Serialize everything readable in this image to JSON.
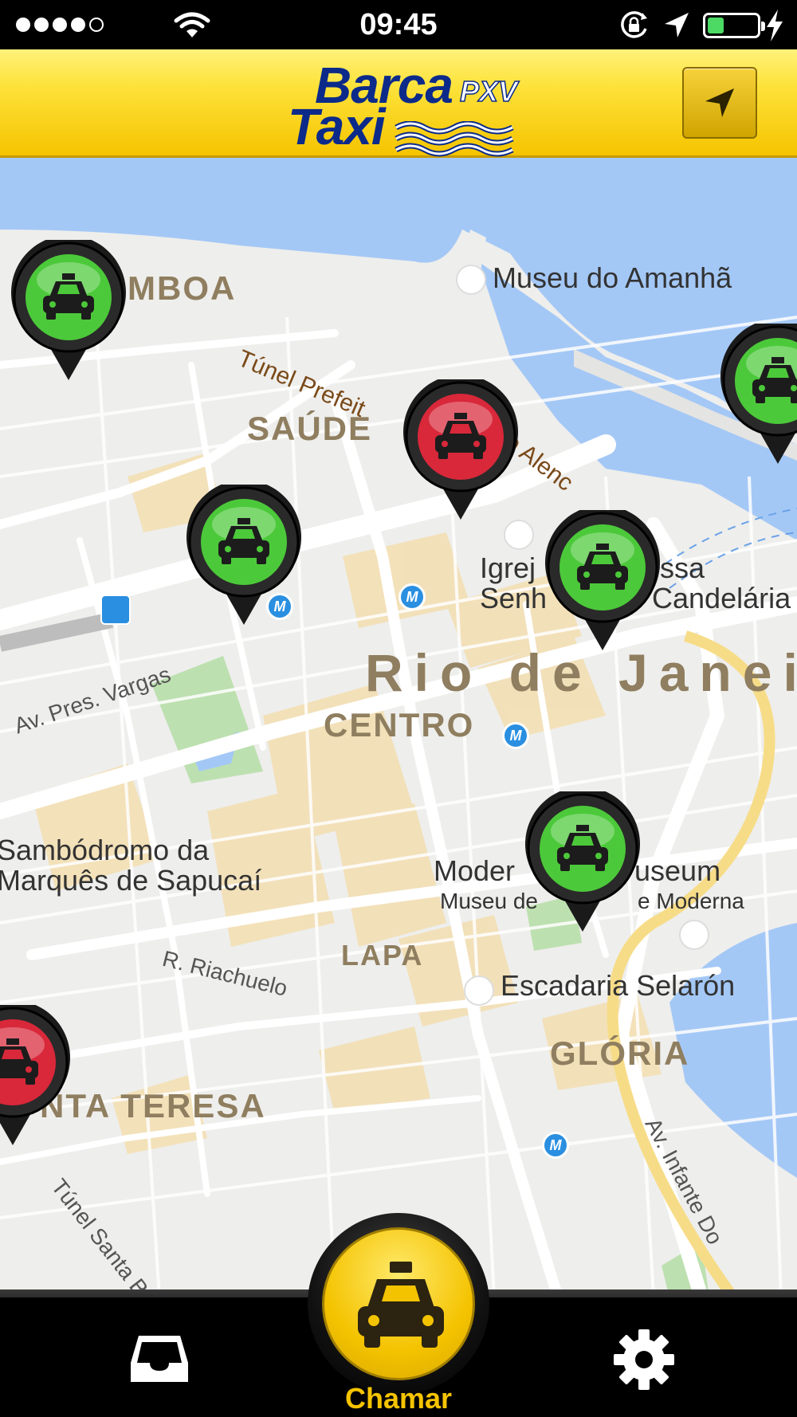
{
  "status_bar": {
    "time": "09:45",
    "signal_bars": 4,
    "battery_level": 0.3,
    "battery_color": "#4cd964"
  },
  "header": {
    "logo": {
      "line1": "Barca",
      "line2": "Taxi",
      "badge": "PXV"
    },
    "locate_icon": "location-arrow-icon",
    "background": "#fbd81e",
    "logo_color": "#0b2a8a"
  },
  "map": {
    "districts": [
      "MBOA",
      "SAÚDE",
      "CENTRO",
      "LAPA",
      "GLÓRIA",
      "NTA TERESA"
    ],
    "city": "Rio de Janei",
    "places": {
      "museu_amanha": "Museu do Amanhã",
      "igreja_line1": "Igrej",
      "igreja_line1b": "ssa",
      "igreja_line2": "Senh",
      "igreja_line2b": "Candelária",
      "sambodromo_line1": "Sambódromo da",
      "sambodromo_line2": "Marquês de Sapucaí",
      "moma_line1a": "Moder",
      "moma_line1b": "useum",
      "moma_line2a": "Museu de",
      "moma_line2b": "e Moderna",
      "escadaria": "Escadaria Selarón"
    },
    "streets": {
      "tunel_prefeito": "Túnel Prefeit",
      "alencar": "o Alenc",
      "pres_vargas": "Av. Pres. Vargas",
      "riachuelo": "R. Riachuelo",
      "infante": "Av. Infante Do",
      "tunel_santa": "Túnel Santa B"
    },
    "metro_badge": "M",
    "taxi_status_colors": {
      "available": "#4cc93a",
      "busy": "#d8283a"
    },
    "taxis": [
      {
        "id": 1,
        "status": "available"
      },
      {
        "id": 2,
        "status": "available"
      },
      {
        "id": 3,
        "status": "busy"
      },
      {
        "id": 4,
        "status": "available"
      },
      {
        "id": 5,
        "status": "available"
      },
      {
        "id": 6,
        "status": "available"
      },
      {
        "id": 7,
        "status": "busy"
      }
    ]
  },
  "bottom_nav": {
    "inbox_icon": "inbox-tray-icon",
    "call_label": "Chamar",
    "call_icon": "taxi-car-icon",
    "settings_icon": "gear-icon"
  }
}
